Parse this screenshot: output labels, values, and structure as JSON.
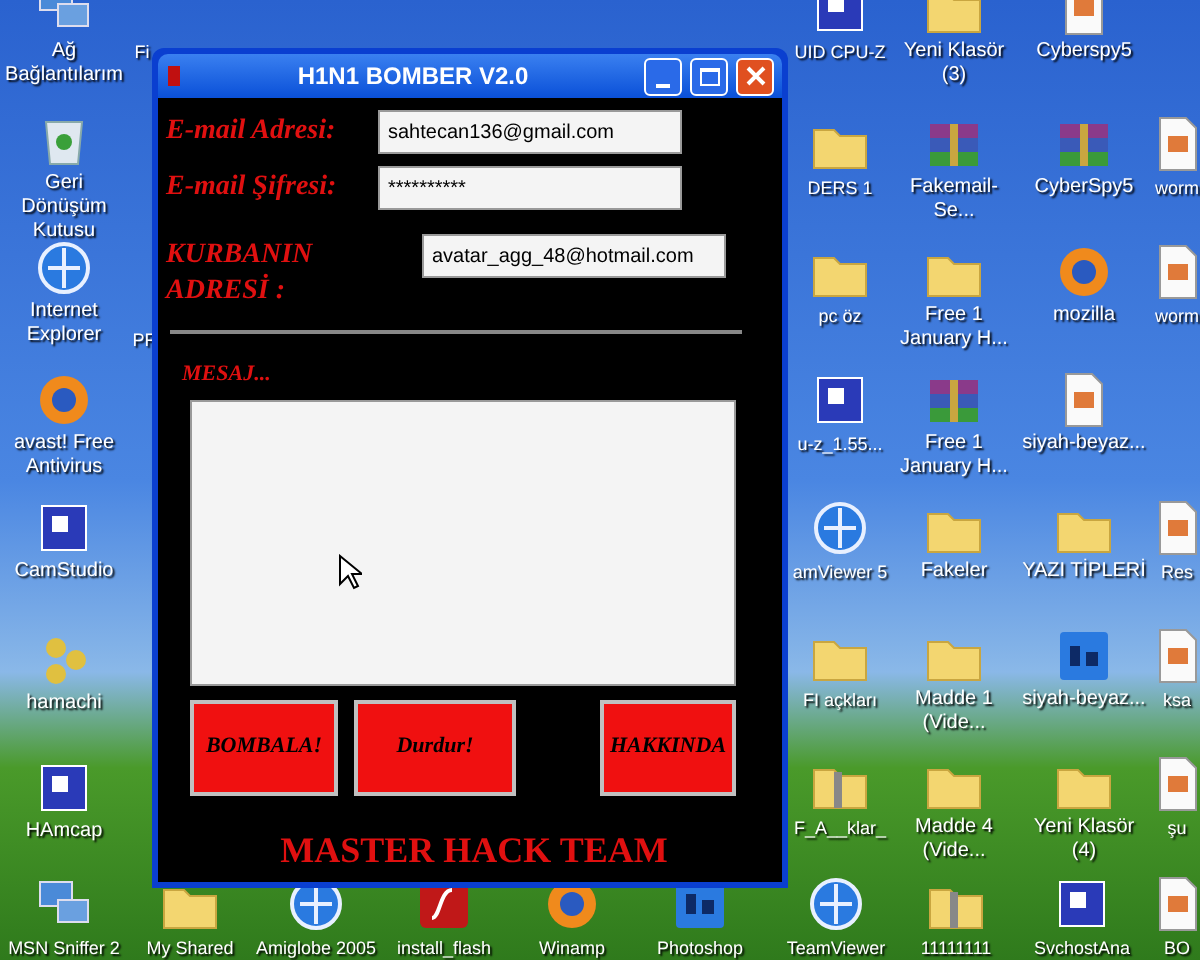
{
  "desktop_icons": [
    {
      "label": "Ağ Bağlantılarım",
      "kind": "network"
    },
    {
      "label": "Geri Dönüşüm Kutusu",
      "kind": "recycle"
    },
    {
      "label": "Internet Explorer",
      "kind": "globe"
    },
    {
      "label": "avast! Free Antivirus",
      "kind": "orange"
    },
    {
      "label": "CamStudio",
      "kind": "app"
    },
    {
      "label": "hamachi",
      "kind": "dots"
    },
    {
      "label": "HAmcap",
      "kind": "app"
    },
    {
      "label": "Fi",
      "kind": "none"
    },
    {
      "label": "PF",
      "kind": "none"
    },
    {
      "label": "UID CPU-Z",
      "kind": "app"
    },
    {
      "label": "Yeni Klasör (3)",
      "kind": "folder"
    },
    {
      "label": "Cyberspy5",
      "kind": "document"
    },
    {
      "label": "DERS 1",
      "kind": "folder"
    },
    {
      "label": "Fakemail-Se...",
      "kind": "archive"
    },
    {
      "label": "CyberSpy5",
      "kind": "archive"
    },
    {
      "label": "worm",
      "kind": "document"
    },
    {
      "label": "pc öz",
      "kind": "folder"
    },
    {
      "label": "Free 1 January H...",
      "kind": "folder"
    },
    {
      "label": "mozilla",
      "kind": "orange"
    },
    {
      "label": "worm",
      "kind": "document"
    },
    {
      "label": "u-z_1.55...",
      "kind": "app"
    },
    {
      "label": "Free 1 January H...",
      "kind": "archive"
    },
    {
      "label": "siyah-beyaz...",
      "kind": "document"
    },
    {
      "label": "amViewer 5",
      "kind": "globe"
    },
    {
      "label": "Fakeler",
      "kind": "folder"
    },
    {
      "label": "YAZI TİPLERİ",
      "kind": "folder"
    },
    {
      "label": "Res",
      "kind": "document"
    },
    {
      "label": "FI açkları",
      "kind": "folder"
    },
    {
      "label": "Madde 1 (Vide...",
      "kind": "folder"
    },
    {
      "label": "siyah-beyaz...",
      "kind": "ps"
    },
    {
      "label": "ksa",
      "kind": "document"
    },
    {
      "label": "F_A__klar_",
      "kind": "zip"
    },
    {
      "label": "Madde 4 (Vide...",
      "kind": "folder"
    },
    {
      "label": "Yeni Klasör (4)",
      "kind": "folder"
    },
    {
      "label": "şu",
      "kind": "document"
    },
    {
      "label": "MSN Sniffer 2",
      "kind": "network"
    },
    {
      "label": "My Shared",
      "kind": "folder"
    },
    {
      "label": "Amiglobe 2005",
      "kind": "globe"
    },
    {
      "label": "install_flash",
      "kind": "red"
    },
    {
      "label": "Winamp",
      "kind": "orange"
    },
    {
      "label": "Photoshop",
      "kind": "ps"
    },
    {
      "label": "TeamViewer",
      "kind": "globe"
    },
    {
      "label": "11111111",
      "kind": "zip"
    },
    {
      "label": "SvchostAna",
      "kind": "app"
    },
    {
      "label": "BO",
      "kind": "document"
    }
  ],
  "window": {
    "title": "H1N1 BOMBER V2.0",
    "fields": [
      {
        "label": "E-mail Adresi:",
        "value": "sahtecan136@gmail.com"
      },
      {
        "label": "E-mail Şifresi:",
        "value": "**********"
      },
      {
        "label": "KURBANIN ADRESİ :",
        "value": "avatar_agg_48@hotmail.com"
      }
    ],
    "message_label": "MESAJ...",
    "buttons": [
      "BOMBALA!",
      "Durdur!",
      "HAKKINDA"
    ],
    "footer": "MASTER HACK TEAM"
  }
}
